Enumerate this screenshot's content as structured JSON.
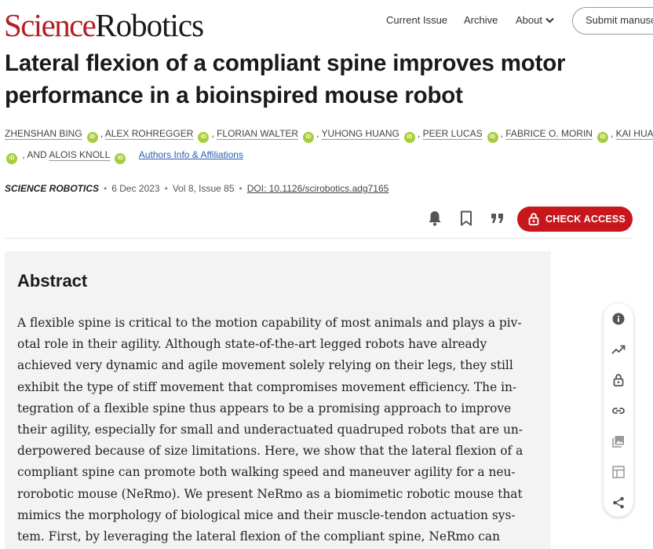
{
  "header": {
    "logo_word1": "Science",
    "logo_word2": "Robotics",
    "nav": {
      "current_issue": "Current Issue",
      "archive": "Archive",
      "about": "About"
    },
    "submit_label": "Submit manuscript"
  },
  "article": {
    "title_line1": "Lateral flexion of a compliant spine improves motor",
    "title_line2": "performance in a bioinspired mouse robot",
    "authors": [
      "ZHENSHAN BING",
      "ALEX ROHREGGER",
      "FLORIAN WALTER",
      "YUHONG HUANG",
      "PEER LUCAS",
      "FABRICE O. MORIN",
      "KAI HUANG",
      "ALOIS KNOLL"
    ],
    "and_text": ", AND",
    "orcid_badge": "iD",
    "affiliations_link": "Authors Info & Affiliations",
    "journal": "SCIENCE ROBOTICS",
    "date": "6 Dec 2023",
    "volume_issue": "Vol 8, Issue 85",
    "doi": "DOI: 10.1126/scirobotics.adg7165",
    "meta_separator": "•"
  },
  "actions": {
    "check_access": "CHECK ACCESS",
    "icons": [
      "bell-icon",
      "bookmark-icon",
      "quote-icon",
      "lock-icon"
    ]
  },
  "abstract": {
    "heading": "Abstract",
    "lines": [
      "A flexible spine is critical to the motion capability of most animals and plays a piv-",
      "otal role in their agility. Although state-of-the-art legged robots have already",
      "achieved very dynamic and agile movement solely relying on their legs, they still",
      "exhibit the type of stiff movement that compromises movement efficiency. The in-",
      "tegration of a flexible spine thus appears to be a promising approach to improve",
      "their agility, especially for small and underactuated quadruped robots that are un-",
      "derpowered because of size limitations. Here, we show that the lateral flexion of a",
      "compliant spine can promote both walking speed and maneuver agility for a neu-",
      "rorobotic mouse (NeRmo). We present NeRmo as a biomimetic robotic mouse that",
      "mimics the morphology of biological mice and their muscle-tendon actuation sys-",
      "tem. First, by leveraging the lateral flexion of the compliant spine, NeRmo can"
    ]
  },
  "side_tools": [
    "info-icon",
    "metrics-icon",
    "lock-icon",
    "link-icon",
    "image-icon",
    "table-icon",
    "share-icon"
  ],
  "colors": {
    "brand_red": "#b41f24",
    "access_red": "#c8161d",
    "orcid_green": "#a6ce39",
    "link_blue": "#2a5db0",
    "abstract_bg": "#f3f3f3"
  }
}
